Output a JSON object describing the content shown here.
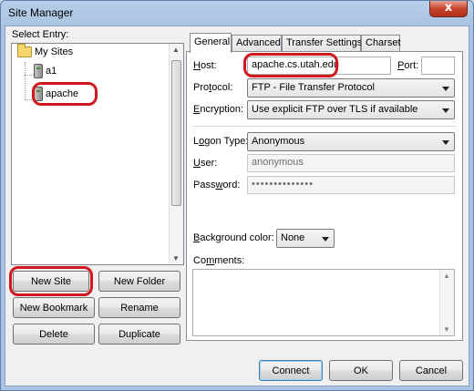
{
  "window": {
    "title": "Site Manager",
    "close_glyph": "x"
  },
  "left": {
    "select_entry_label": "Select Entry:",
    "tree": {
      "root": "My Sites",
      "children": [
        "a1",
        "apache"
      ]
    },
    "buttons": {
      "new_site": "New Site",
      "new_folder": "New Folder",
      "new_bookmark": "New Bookmark",
      "rename": "Rename",
      "delete": "Delete",
      "duplicate": "Duplicate"
    }
  },
  "tabs": [
    "General",
    "Advanced",
    "Transfer Settings",
    "Charset"
  ],
  "general": {
    "host_label": "Host:",
    "host_value": "apache.cs.utah.edu",
    "port_label": "Port:",
    "port_value": "",
    "protocol_label": "Protocol:",
    "protocol_value": "FTP - File Transfer Protocol",
    "encryption_label": "Encryption:",
    "encryption_value": "Use explicit FTP over TLS if available",
    "logon_type_label": "Logon Type:",
    "logon_type_value": "Anonymous",
    "user_label": "User:",
    "user_value": "anonymous",
    "password_label": "Password:",
    "password_value": "••••••••••••••",
    "background_color_label": "Background color:",
    "background_color_value": "None",
    "comments_label": "Comments:",
    "comments_value": ""
  },
  "footer": {
    "connect": "Connect",
    "ok": "OK",
    "cancel": "Cancel"
  },
  "colors": {
    "highlight_marker": "#d1181f",
    "title_bar": "#b9cfe9"
  }
}
